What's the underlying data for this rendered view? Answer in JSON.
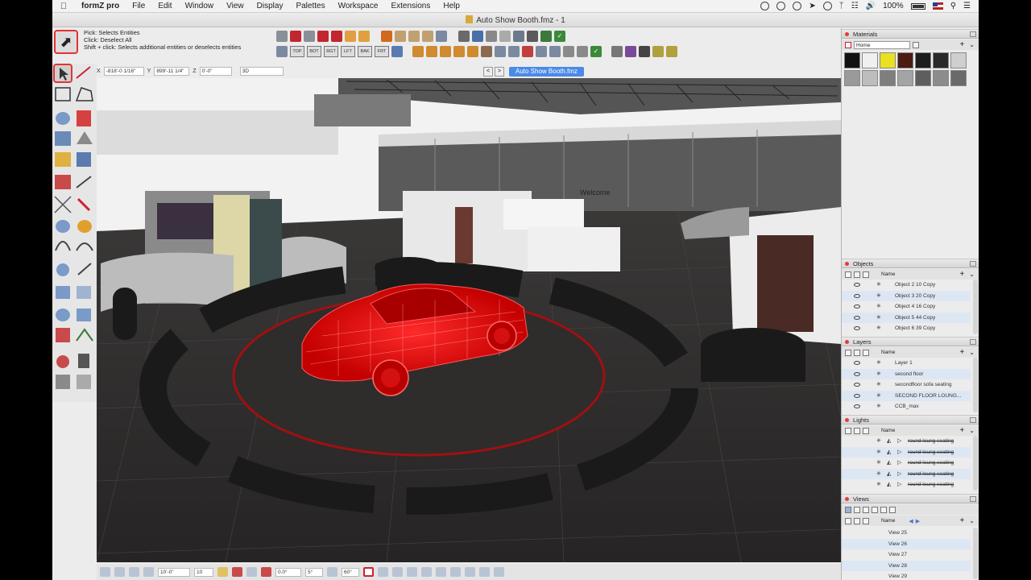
{
  "menubar": {
    "app_name": "formZ pro",
    "items": [
      "File",
      "Edit",
      "Window",
      "View",
      "Display",
      "Palettes",
      "Workspace",
      "Extensions",
      "Help"
    ],
    "battery": "100%"
  },
  "window": {
    "title": "Auto Show Booth.fmz - 1"
  },
  "hint": {
    "line1": "Pick:  Selects Entities",
    "line2": "Click: Deselect All",
    "line3": "Shift + click: Selects additional entities or deselects entities"
  },
  "view_buttons": [
    "TOP",
    "BOT",
    "RGT",
    "LFT",
    "BAK",
    "FRT"
  ],
  "coords": {
    "x_label": "X",
    "x_value": "-818'-0 1/16\"",
    "y_label": "Y",
    "y_value": "899'-11 1/4\"",
    "z_label": "Z",
    "z_value": "0'-0\"",
    "mode": "3D"
  },
  "doc_tab": "Auto Show Booth.fmz",
  "viewport": {
    "welcome_sign": "Welcome"
  },
  "bottombar": {
    "grid_value": "10'-0\"",
    "snap_value": "10",
    "angle_value": "0.0°",
    "angle2_value": "5°",
    "angle3_value": "60°"
  },
  "panels": {
    "materials": {
      "title": "Materials",
      "folder": "Home",
      "swatches": [
        "#111111",
        "#f0f0f0",
        "#e8e020",
        "#4a1c12",
        "#1d1d1d",
        "#2a2a2a",
        "#cfcfcf",
        "#9a9a9a",
        "#bdbdbd",
        "#7e7e7e",
        "#a4a4a4",
        "#5e5e5e",
        "#8c8c8c",
        "#6a6a6a"
      ]
    },
    "objects": {
      "title": "Objects",
      "column": "Name",
      "rows": [
        "Object 2 10 Copy",
        "Object 3 20 Copy",
        "Object 4 16 Copy",
        "Object 5 44 Copy",
        "Object 6 39 Copy"
      ]
    },
    "layers": {
      "title": "Layers",
      "column": "Name",
      "rows": [
        "Layer 1",
        "second floor",
        "secondfloor sofa seating",
        "SECOND FLOOR LOUNG...",
        "CCB_max"
      ]
    },
    "lights": {
      "title": "Lights",
      "column": "Name",
      "rows": [
        "round loung seating",
        "round loung seating",
        "round loung seating",
        "round loung seating",
        "round loung seating"
      ]
    },
    "views": {
      "title": "Views",
      "column": "Name",
      "rows": [
        "View 25",
        "View 26",
        "View 27",
        "View 28",
        "View 29"
      ]
    }
  }
}
